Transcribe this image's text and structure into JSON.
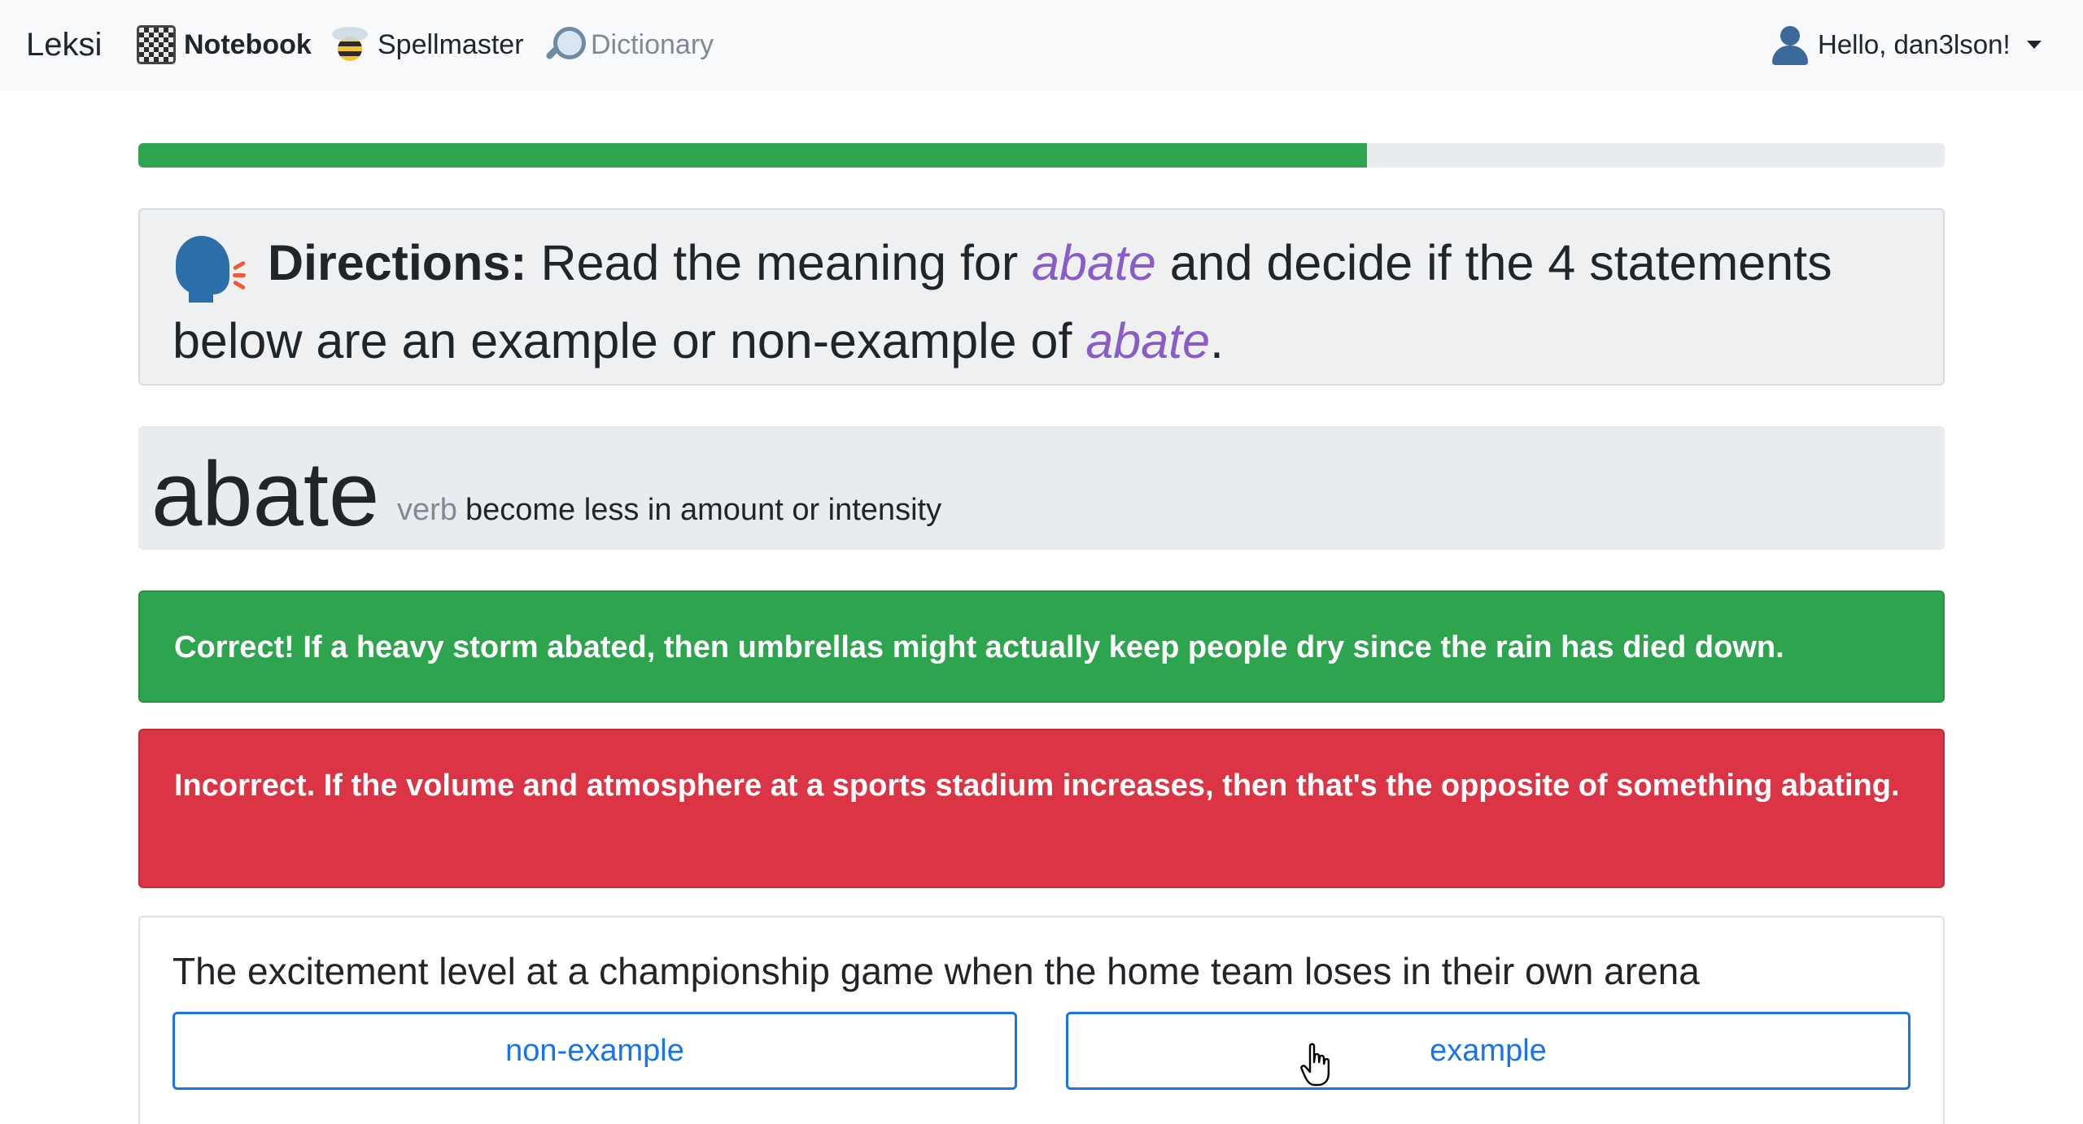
{
  "navbar": {
    "brand": "Leksi",
    "items": [
      {
        "label": "Notebook",
        "icon": "notebook-icon",
        "active": true
      },
      {
        "label": "Spellmaster",
        "icon": "bee-icon",
        "active": false
      },
      {
        "label": "Dictionary",
        "icon": "magnifier-icon",
        "active": false
      }
    ],
    "user_greeting": "Hello, dan3lson!"
  },
  "progress": {
    "percent": 68
  },
  "directions": {
    "label": "Directions:",
    "text_part1": " Read the meaning for ",
    "word1": "abate",
    "text_part2": " and decide if the 4 statements below are an example or non-example of ",
    "word2": "abate",
    "text_end": "."
  },
  "definition": {
    "word": "abate",
    "part_of_speech": "verb",
    "meaning": "become less in amount or intensity"
  },
  "feedback": {
    "correct": "Correct! If a heavy storm abated, then umbrellas might actually keep people dry since the rain has died down.",
    "incorrect": "Incorrect. If the volume and atmosphere at a sports stadium increases, then that's the opposite of something abating."
  },
  "question": {
    "statement": "The excitement level at a championship game when the home team loses in their own arena",
    "options": [
      "non-example",
      "example"
    ]
  },
  "colors": {
    "success": "#2ea44f",
    "danger": "#db3545",
    "accent": "#1a73e8",
    "word_highlight": "#8a5cc7"
  }
}
